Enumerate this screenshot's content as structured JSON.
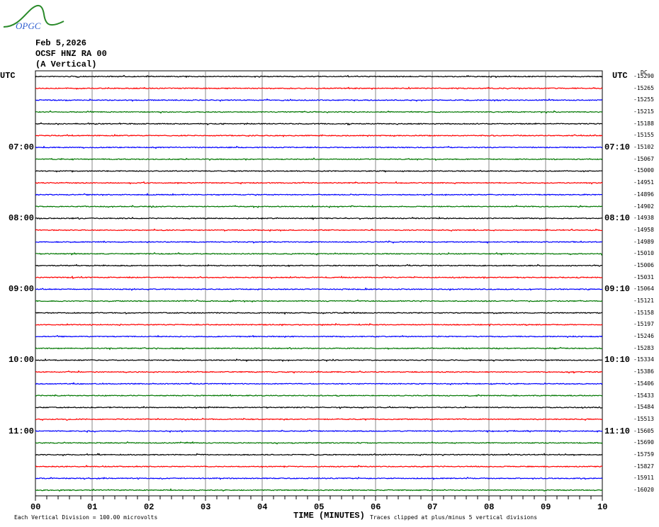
{
  "logo_text": "OPGC",
  "header": {
    "date": "Feb 5,2026",
    "station": "OCSF HNZ RA 00",
    "component": "(A Vertical)"
  },
  "utc_left": "UTC",
  "utc_right": "UTC",
  "dc_label": "DC",
  "colors": [
    "#000000",
    "#ff0000",
    "#0000ff",
    "#007700"
  ],
  "chart_data": {
    "type": "line",
    "title": "OCSF HNZ RA 00 (A Vertical) Feb 5,2026",
    "xlabel": "TIME (MINUTES)",
    "x_ticks": [
      "00",
      "01",
      "02",
      "03",
      "04",
      "05",
      "06",
      "07",
      "08",
      "09",
      "10"
    ],
    "xlim": [
      0,
      10
    ],
    "trace_count": 36,
    "left_time_labels": [
      {
        "row": 6,
        "label": "07:00"
      },
      {
        "row": 12,
        "label": "08:00"
      },
      {
        "row": 18,
        "label": "09:00"
      },
      {
        "row": 24,
        "label": "10:00"
      },
      {
        "row": 30,
        "label": "11:00"
      }
    ],
    "right_time_labels": [
      {
        "row": 6,
        "label": "07:10"
      },
      {
        "row": 12,
        "label": "08:10"
      },
      {
        "row": 18,
        "label": "09:10"
      },
      {
        "row": 24,
        "label": "10:10"
      },
      {
        "row": 30,
        "label": "11:10"
      }
    ],
    "dc_offsets": [
      "-15290",
      "-15265",
      "-15255",
      "-15215",
      "-15188",
      "-15155",
      "-15102",
      "-15067",
      "-15000",
      "-14951",
      "-14896",
      "-14902",
      "-14938",
      "-14958",
      "-14989",
      "-15010",
      "-15006",
      "-15031",
      "-15064",
      "-15121",
      "-15158",
      "-15197",
      "-15246",
      "-15283",
      "-15334",
      "-15386",
      "-15406",
      "-15433",
      "-15484",
      "-15513",
      "-15605",
      "-15690",
      "-15759",
      "-15827",
      "-15911",
      "-16020"
    ],
    "scale_note": "Each Vertical Division =  100.00 microvolts",
    "clip_note": "Traces clipped at plus/minus 5 vertical divisions"
  }
}
